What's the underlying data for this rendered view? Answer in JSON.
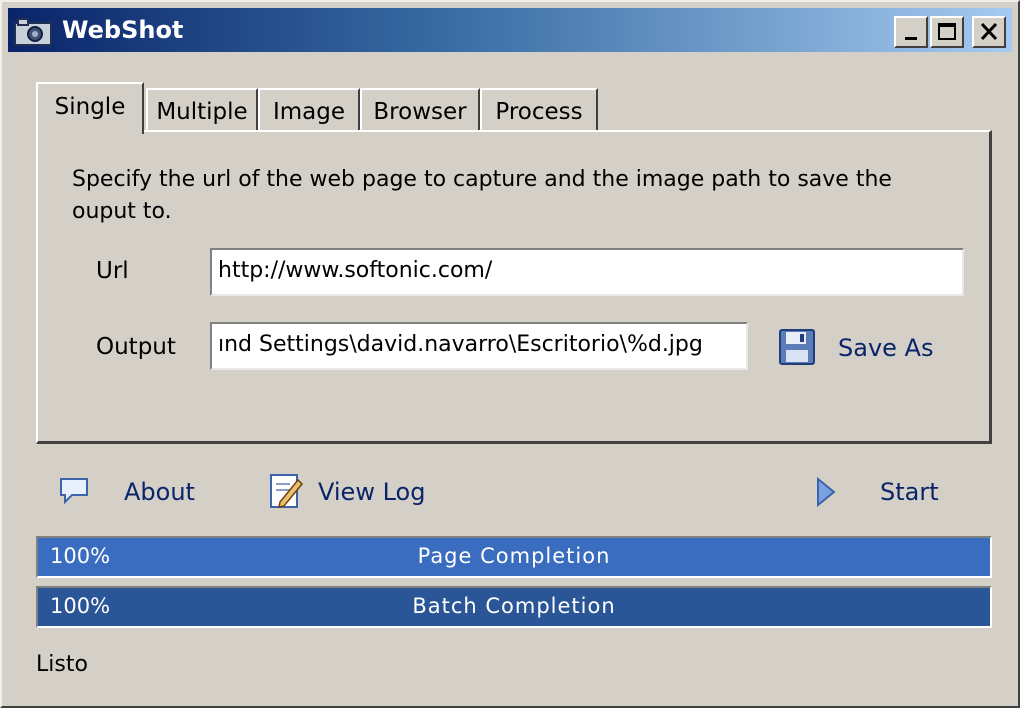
{
  "window": {
    "title": "WebShot"
  },
  "titlebar_buttons": {
    "minimize": "minimize",
    "maximize": "maximize",
    "close": "close"
  },
  "tabs": [
    {
      "label": "Single",
      "active": true
    },
    {
      "label": "Multiple",
      "active": false
    },
    {
      "label": "Image",
      "active": false
    },
    {
      "label": "Browser",
      "active": false
    },
    {
      "label": "Process",
      "active": false
    }
  ],
  "single": {
    "description": "Specify the url of the web page to capture and the image path to save the ouput to.",
    "url_label": "Url",
    "url_value": "http://www.softonic.com/",
    "output_label": "Output",
    "output_value": "ınd Settings\\david.navarro\\Escritorio\\%d.jpg",
    "save_as_label": "Save As",
    "save_as_icon": "floppy-disk-icon"
  },
  "actions": {
    "about_label": "About",
    "about_icon": "speech-bubble-icon",
    "view_log_label": "View Log",
    "view_log_icon": "notepad-pencil-icon",
    "start_label": "Start",
    "start_icon": "play-triangle-icon"
  },
  "progress": {
    "page": {
      "percent_text": "100%",
      "label": "Page Completion",
      "value": 1.0,
      "color": "#3a6dbf"
    },
    "batch": {
      "percent_text": "100%",
      "label": "Batch Completion",
      "value": 1.0,
      "color": "#2a5597"
    }
  },
  "status_text": "Listo",
  "colors": {
    "accent": "#0a246a",
    "face": "#d4d0c8",
    "link": "#0a246a"
  }
}
